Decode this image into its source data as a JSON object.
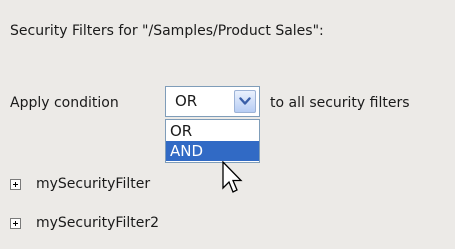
{
  "header": {
    "title": "Security Filters for \"/Samples/Product Sales\":"
  },
  "condition": {
    "prefix_label": "Apply condition",
    "selected_value": "OR",
    "suffix_label": "to all security filters",
    "options": [
      "OR",
      "AND"
    ],
    "highlighted_option": "AND"
  },
  "filters": [
    {
      "name": "mySecurityFilter"
    },
    {
      "name": "mySecurityFilter2"
    }
  ],
  "colors": {
    "highlight": "#316AC5",
    "background": "#ECEAE7"
  },
  "icons": {
    "dropdown": "chevron-down-icon",
    "expand": "plus-icon",
    "cursor": "arrow-cursor-icon"
  }
}
